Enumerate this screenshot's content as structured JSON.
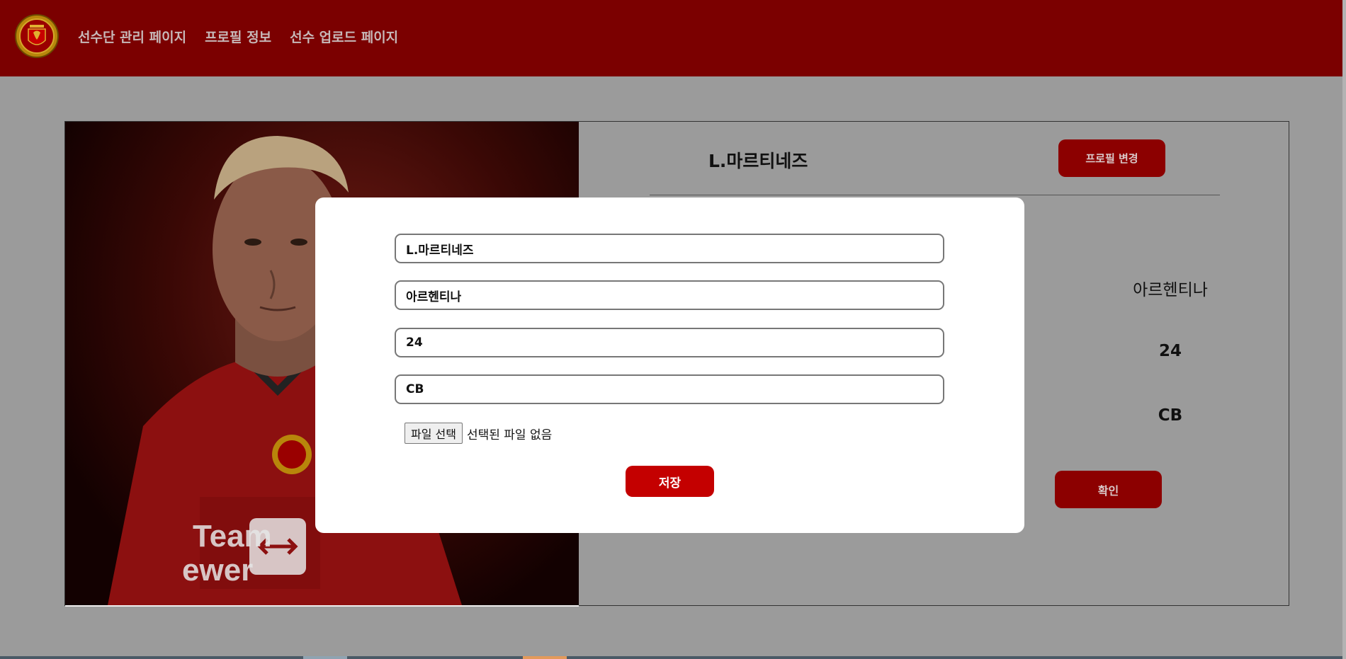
{
  "header": {
    "nav": [
      {
        "label": "선수단 관리 페이지"
      },
      {
        "label": "프로필 정보"
      },
      {
        "label": "선수 업로드 페이지"
      }
    ],
    "background_color": "#7b0000"
  },
  "profile": {
    "name": "L.마르티네즈",
    "change_button": "프로필 변경",
    "nationality": "아르헨티나",
    "age": "24",
    "position": "CB",
    "confirm_button": "확인",
    "photo_alt": "player-photo"
  },
  "modal": {
    "name_value": "L.마르티네즈",
    "nation_value": "아르헨티나",
    "age_value": "24",
    "position_value": "CB",
    "file_button": "파일 선택",
    "file_status": "선택된 파일 없음",
    "save_button": "저장",
    "save_color": "#c40000"
  }
}
